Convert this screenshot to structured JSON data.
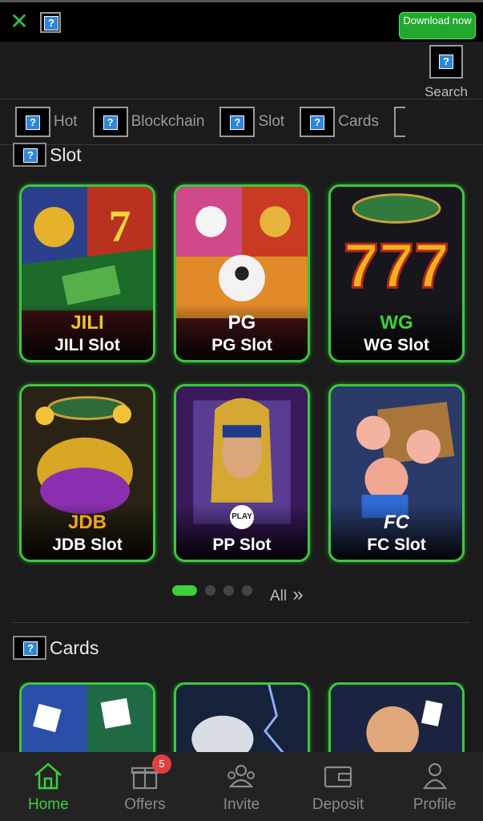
{
  "topbar": {
    "download_label": "Download now"
  },
  "search": {
    "label": "Search"
  },
  "tabs": [
    {
      "label": "Hot"
    },
    {
      "label": "Blockchain"
    },
    {
      "label": "Slot"
    },
    {
      "label": "Cards"
    }
  ],
  "slot_section": {
    "title": "Slot",
    "providers": [
      {
        "brand": "JILI",
        "name": "JILI Slot",
        "brand_color": "#f3c22b"
      },
      {
        "brand": "PG",
        "name": "PG Slot",
        "brand_color": "#ffffff"
      },
      {
        "brand": "WG",
        "name": "WG Slot",
        "brand_color": "#3cd03c"
      },
      {
        "brand": "JDB",
        "name": "JDB Slot",
        "brand_color": "#f2a51c"
      },
      {
        "brand": "PLAY",
        "name": "PP Slot",
        "brand_color": "#ffffff"
      },
      {
        "brand": "FC",
        "name": "FC Slot",
        "brand_color": "#ffffff"
      }
    ],
    "pagination": {
      "pages": 4,
      "current": 1
    },
    "all_label": "All"
  },
  "cards_section": {
    "title": "Cards"
  },
  "bottom_nav": {
    "items": [
      {
        "label": "Home",
        "icon": "home-icon",
        "active": true
      },
      {
        "label": "Offers",
        "icon": "gift-icon",
        "badge": "5"
      },
      {
        "label": "Invite",
        "icon": "invite-icon"
      },
      {
        "label": "Deposit",
        "icon": "wallet-icon"
      },
      {
        "label": "Profile",
        "icon": "profile-icon"
      }
    ]
  },
  "colors": {
    "accent": "#3cd03c",
    "badge": "#e04040",
    "background": "#1b1b1b"
  }
}
